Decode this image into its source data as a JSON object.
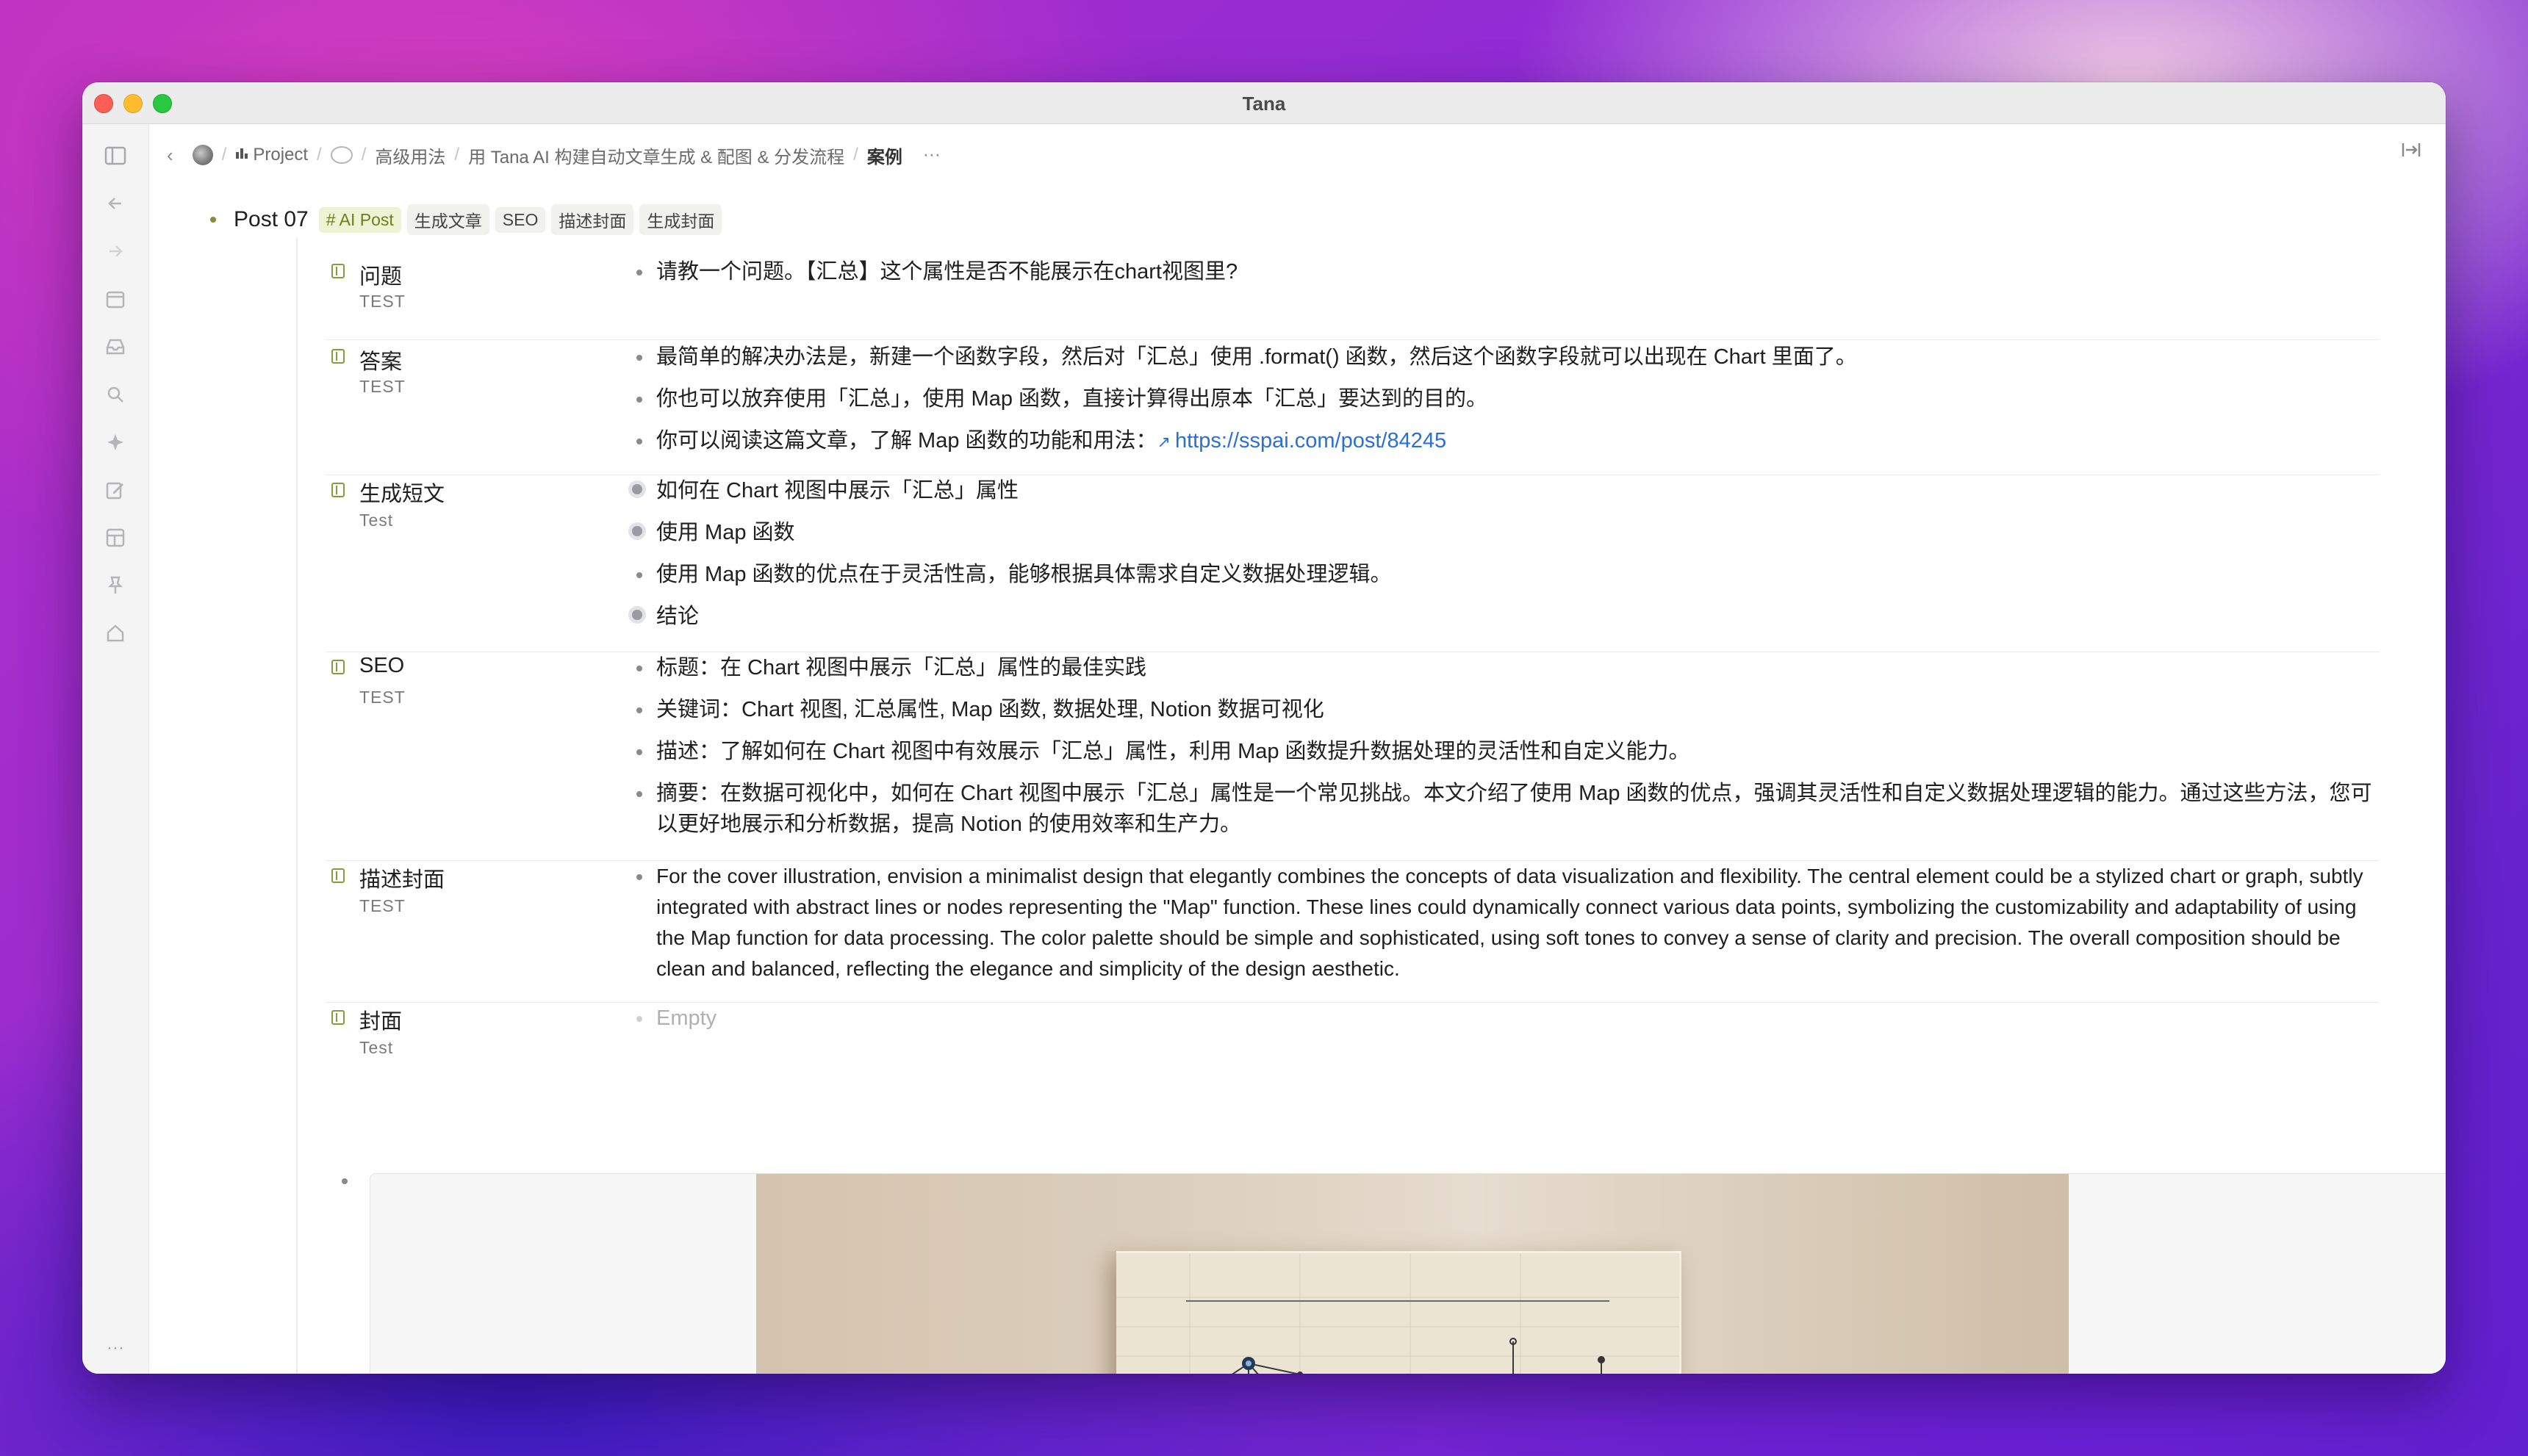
{
  "window": {
    "title": "Tana"
  },
  "sidebar": {
    "icons": [
      "panel-toggle-icon",
      "back-arrow-icon",
      "forward-arrow-icon",
      "calendar-icon",
      "inbox-icon",
      "search-icon",
      "sparkle-icon",
      "edit-icon",
      "layout-icon",
      "pin-icon",
      "home-icon"
    ],
    "more": "···"
  },
  "breadcrumb": {
    "back": "‹",
    "items": [
      "Project",
      "高级用法",
      "用 Tana AI 构建自动文章生成 & 配图 & 分发流程",
      "案例"
    ],
    "more": "···"
  },
  "post": {
    "title": "Post 07",
    "tags": [
      "# AI Post",
      "生成文章",
      "SEO",
      "描述封面",
      "生成封面"
    ]
  },
  "fields": [
    {
      "name": "问题",
      "sub": "TEST",
      "values": [
        "请教一个问题。【汇总】这个属性是否不能展示在chart视图里?"
      ]
    },
    {
      "name": "答案",
      "sub": "TEST",
      "values": [
        "最简单的解决办法是，新建一个函数字段，然后对「汇总」使用 .format() 函数，然后这个函数字段就可以出现在 Chart 里面了。",
        "你也可以放弃使用「汇总」，使用 Map 函数，直接计算得出原本「汇总」要达到的目的。",
        "你可以阅读这篇文章，了解 Map 函数的功能和用法："
      ],
      "link": "https://sspai.com/post/84245"
    },
    {
      "name": "生成短文",
      "sub": "Test",
      "values": [
        "如何在 Chart 视图中展示「汇总」属性",
        "使用 Map 函数",
        "使用 Map 函数的优点在于灵活性高，能够根据具体需求自定义数据处理逻辑。",
        "结论"
      ]
    },
    {
      "name": "SEO",
      "sub": "TEST",
      "values": [
        "标题：在 Chart 视图中展示「汇总」属性的最佳实践",
        "关键词：Chart 视图, 汇总属性, Map 函数, 数据处理, Notion 数据可视化",
        "描述：了解如何在 Chart 视图中有效展示「汇总」属性，利用 Map 函数提升数据处理的灵活性和自定义能力。",
        "摘要：在数据可视化中，如何在 Chart 视图中展示「汇总」属性是一个常见挑战。本文介绍了使用 Map 函数的优点，强调其灵活性和自定义数据处理逻辑的能力。通过这些方法，您可以更好地展示和分析数据，提高 Notion 的使用效率和生产力。"
      ]
    },
    {
      "name": "描述封面",
      "sub": "TEST",
      "values": [
        "For the cover illustration, envision a minimalist design that elegantly combines the concepts of data visualization and flexibility. The central element could be a stylized chart or graph, subtly integrated with abstract lines or nodes representing the \"Map\" function. These lines could dynamically connect various data points, symbolizing the customizability and adaptability of using the Map function for data processing. The color palette should be simple and sophisticated, using soft tones to convey a sense of clarity and precision. The overall composition should be clean and balanced, reflecting the elegance and simplicity of the design aesthetic."
      ]
    },
    {
      "name": "封面",
      "sub": "Test",
      "values": [
        "Empty"
      ]
    }
  ]
}
